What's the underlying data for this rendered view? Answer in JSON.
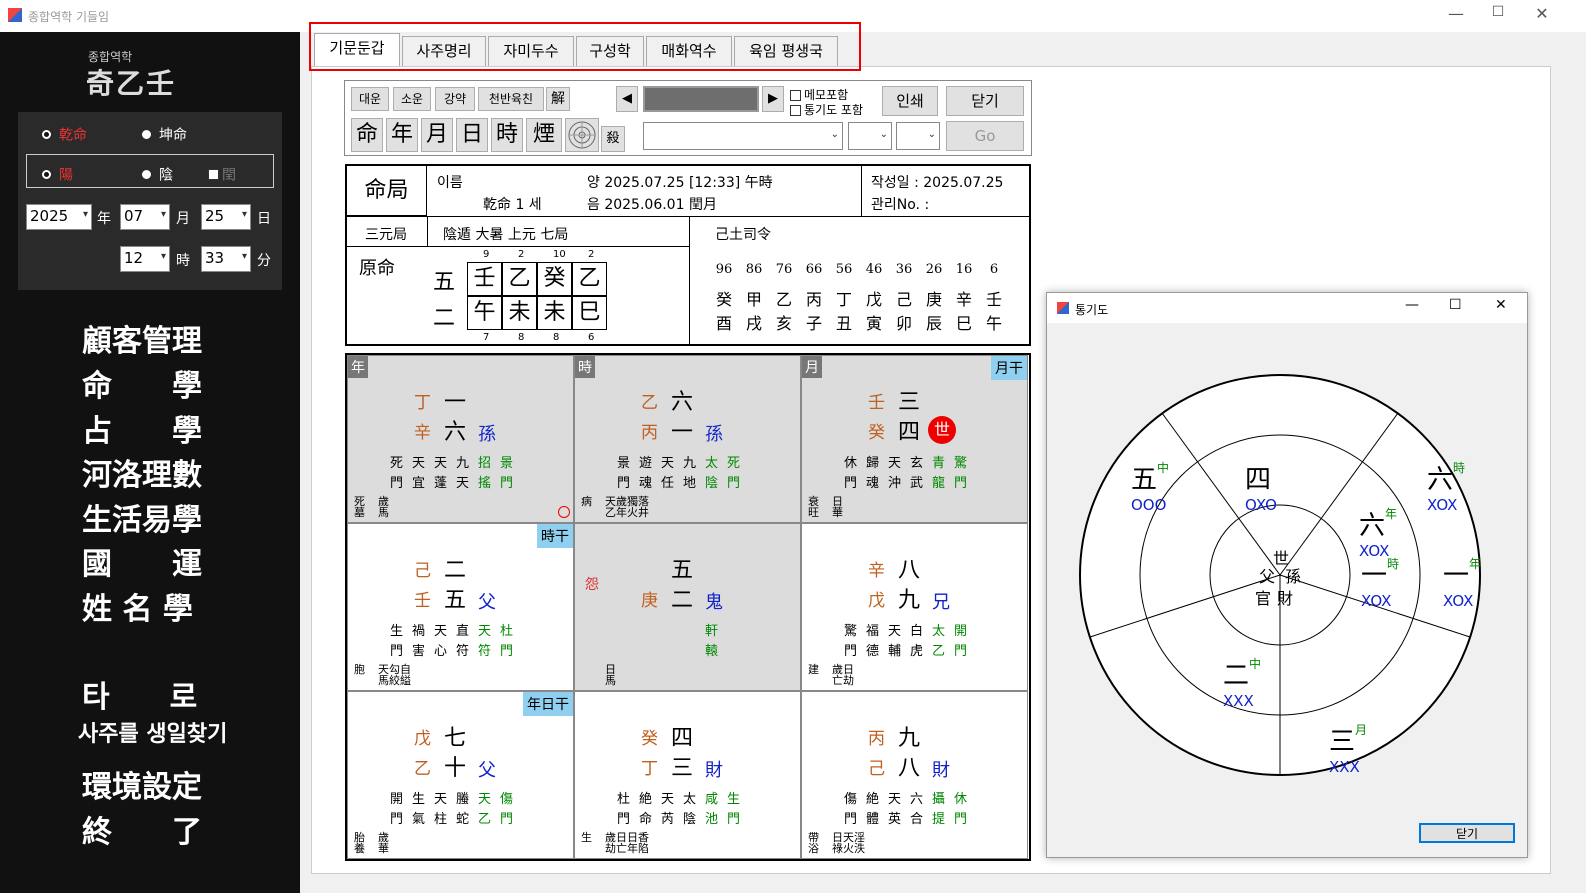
{
  "window": {
    "title": "종합역학 기들임",
    "min": "—",
    "max": "☐",
    "close": "✕"
  },
  "sidebar": {
    "logo_small": "종합역학",
    "logo_main": "奇乙壬",
    "gender": {
      "male": "乾命",
      "female": "坤命"
    },
    "cal": {
      "solar": "陽",
      "lunar": "陰",
      "leap": "閏"
    },
    "year": "2025",
    "year_unit": "年",
    "month": "07",
    "month_unit": "月",
    "day": "25",
    "day_unit": "日",
    "hour": "12",
    "hour_unit": "時",
    "minute": "33",
    "minute_unit": "分",
    "menu": [
      "顧客管理",
      "命　　學",
      "占　　學",
      "河洛理數",
      "生活易學",
      "國　　運",
      "姓 名 學",
      "타　　로",
      "사주를 생일찾기",
      "環境設定",
      "終　　了"
    ]
  },
  "tabs": [
    "기문둔갑",
    "사주명리",
    "자미두수",
    "구성학",
    "매화역수",
    "육임 평생국"
  ],
  "toolbar": {
    "small_btns": [
      "대운",
      "소운",
      "강약",
      "천반육친",
      "解"
    ],
    "big_btns": [
      "命",
      "年",
      "月",
      "日",
      "時",
      "煙"
    ],
    "sal": "殺",
    "prev": "◀",
    "next": "▶",
    "memo": "메모포함",
    "tonggi": "통기도 포함",
    "print": "인쇄",
    "close": "닫기",
    "go": "Go"
  },
  "chart": {
    "title": "命局",
    "name_label": "이름",
    "gender_age": "乾命 1 세",
    "solar": "양 2025.07.25  [12:33]  午時",
    "lunar": "음 2025.06.01  閏月",
    "created": "작성일 : 2025.07.25",
    "manage_no": "관리No. :",
    "sanwon": "三元局",
    "ju": "陰遁 大暑 上元 七局",
    "saryeong": "己土司令",
    "wonmyeong": "原命",
    "row_labels": [
      "五",
      "二"
    ],
    "stems": [
      "壬",
      "乙",
      "癸",
      "乙"
    ],
    "branches": [
      "午",
      "未",
      "未",
      "巳"
    ],
    "top_nums": [
      "9",
      "2",
      "10",
      "2"
    ],
    "bot_nums": [
      "7",
      "8",
      "8",
      "6"
    ],
    "daeun_ages": [
      "96",
      "86",
      "76",
      "66",
      "56",
      "46",
      "36",
      "26",
      "16",
      "6"
    ],
    "daeun_stems": [
      "癸",
      "甲",
      "乙",
      "丙",
      "丁",
      "戊",
      "己",
      "庚",
      "辛",
      "壬"
    ],
    "daeun_branches": [
      "酉",
      "戌",
      "亥",
      "子",
      "丑",
      "寅",
      "卯",
      "辰",
      "巳",
      "午"
    ]
  },
  "cells": [
    {
      "corner": "年",
      "badge": "",
      "stem1": "丁",
      "num1": "一",
      "stem2": "辛",
      "num2": "六",
      "rel": "孫",
      "l1": [
        "死",
        "天",
        "天",
        "九",
        "招",
        "景"
      ],
      "l2": [
        "門",
        "宜",
        "蓬",
        "天",
        "搖",
        "門"
      ],
      "bl": "死\n墓",
      "bl2": "歲\n馬",
      "gray": true,
      "circle": true
    },
    {
      "corner": "時",
      "badge": "",
      "stem1": "乙",
      "num1": "六",
      "stem2": "丙",
      "num2": "一",
      "rel": "孫",
      "l1": [
        "景",
        "遊",
        "天",
        "九",
        "太",
        "死"
      ],
      "l2": [
        "門",
        "魂",
        "任",
        "地",
        "陰",
        "門"
      ],
      "bl": "病",
      "bl2": "天歲獨落\n乙年火井",
      "gray": true
    },
    {
      "corner": "月",
      "badge": "月干",
      "stem1": "壬",
      "num1": "三",
      "stem2": "癸",
      "num2": "四",
      "rel": "世",
      "l1": [
        "休",
        "歸",
        "天",
        "玄",
        "青",
        "驚"
      ],
      "l2": [
        "門",
        "魂",
        "沖",
        "武",
        "龍",
        "門"
      ],
      "bl": "衰\n旺",
      "bl2": "日\n華",
      "gray": true
    },
    {
      "corner": "",
      "badge": "時干",
      "stem1": "己",
      "num1": "二",
      "stem2": "壬",
      "num2": "五",
      "rel": "父",
      "l1": [
        "生",
        "禍",
        "天",
        "直",
        "天",
        "杜"
      ],
      "l2": [
        "門",
        "害",
        "心",
        "符",
        "符",
        "門"
      ],
      "bl": "胞",
      "bl2": "天勾自\n馬絞縊"
    },
    {
      "corner": "",
      "badge": "",
      "side": "怨",
      "stem1": "",
      "num1": "五",
      "stem2": "庚",
      "num2": "二",
      "rel": "鬼",
      "l1": [
        "",
        "",
        "",
        "",
        "軒",
        ""
      ],
      "l2": [
        "",
        "",
        "",
        "",
        "轅",
        ""
      ],
      "bl": "",
      "bl2": "日\n馬",
      "gray": true
    },
    {
      "corner": "",
      "badge": "",
      "stem1": "辛",
      "num1": "八",
      "stem2": "戊",
      "num2": "九",
      "rel": "兄",
      "l1": [
        "驚",
        "福",
        "天",
        "白",
        "太",
        "開"
      ],
      "l2": [
        "門",
        "德",
        "輔",
        "虎",
        "乙",
        "門"
      ],
      "bl": "建",
      "bl2": "歲日\n亡劫"
    },
    {
      "corner": "",
      "badge": "年日干",
      "stem1": "戊",
      "num1": "七",
      "stem2": "乙",
      "num2": "十",
      "rel": "父",
      "l1": [
        "開",
        "生",
        "天",
        "螣",
        "天",
        "傷"
      ],
      "l2": [
        "門",
        "氣",
        "柱",
        "蛇",
        "乙",
        "門"
      ],
      "bl": "胎\n養",
      "bl2": "歲\n華"
    },
    {
      "corner": "",
      "badge": "",
      "stem1": "癸",
      "num1": "四",
      "stem2": "丁",
      "num2": "三",
      "rel": "財",
      "l1": [
        "杜",
        "絶",
        "天",
        "太",
        "咸",
        "生"
      ],
      "l2": [
        "門",
        "命",
        "芮",
        "陰",
        "池",
        "門"
      ],
      "bl": "生",
      "bl2": "歲日日香\n劫亡年陷"
    },
    {
      "corner": "",
      "badge": "",
      "stem1": "丙",
      "num1": "九",
      "stem2": "己",
      "num2": "八",
      "rel": "財",
      "l1": [
        "傷",
        "絶",
        "天",
        "六",
        "攝",
        "休"
      ],
      "l2": [
        "門",
        "體",
        "英",
        "合",
        "提",
        "門"
      ],
      "bl": "帶\n浴",
      "bl2": "日天淫\n祿火泆"
    }
  ],
  "dialog": {
    "title": "통기도",
    "close_btn": "닫기",
    "center": {
      "top": "世",
      "left": "父",
      "right": "孫",
      "bottom_left": "官",
      "bottom_right": "財"
    },
    "items": [
      {
        "n": "五",
        "sup": "中",
        "code": "OOO"
      },
      {
        "n": "四",
        "sup": "",
        "code": "OXO"
      },
      {
        "n": "六",
        "sup": "時",
        "code": "XOX"
      },
      {
        "n": "六",
        "sup": "年",
        "code": "XOX"
      },
      {
        "n": "一",
        "sup": "時",
        "code": "XOX"
      },
      {
        "n": "一",
        "sup": "年",
        "code": "XOX"
      },
      {
        "n": "二",
        "sup": "中",
        "code": "XXX"
      },
      {
        "n": "三",
        "sup": "月",
        "code": "XXX"
      }
    ]
  },
  "colors": {
    "accent_red": "#e00000",
    "blue": "#1428c8",
    "green": "#008000",
    "stem": "#c06020",
    "badge": "#8fd0f0"
  }
}
